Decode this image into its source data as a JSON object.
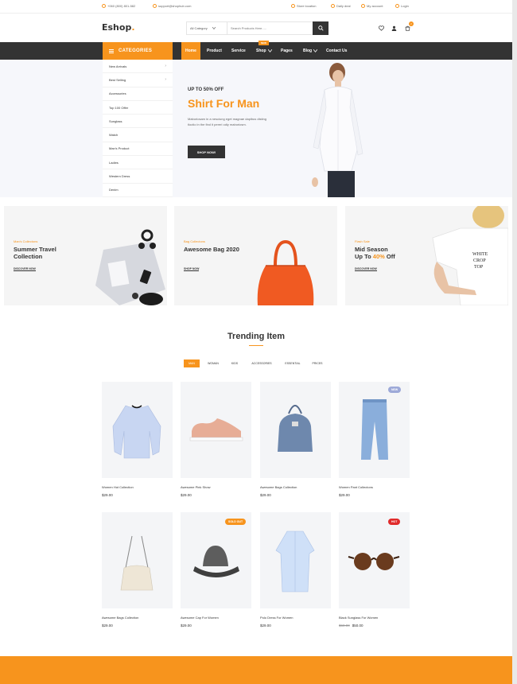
{
  "topbar": {
    "phone": "+060 (800) 801-582",
    "email": "support@shophub.com",
    "store_location": "Store location",
    "daily_deal": "Daily deal",
    "my_account": "My account",
    "login": "Login"
  },
  "header": {
    "logo": "Eshop",
    "logo_dot": ".",
    "category_select": "All Category",
    "search_placeholder": "Search Products Here.....",
    "cart_count": "2"
  },
  "nav": {
    "categories_label": "CATEGORIES",
    "items": [
      "Home",
      "Product",
      "Service",
      "Shop",
      "Pages",
      "Blog",
      "Contact Us"
    ],
    "shop_badge": "NEW"
  },
  "categories": [
    "New Arrivals",
    "Best Selling",
    "Accessories",
    "Top 100 Offer",
    "Sunglass",
    "Watch",
    "Man's Product",
    "Ladies",
    "Western Dress",
    "Denim"
  ],
  "hero": {
    "small": "UP TO 50% OFF",
    "title": "Shirt For Man",
    "desc": "Maboriosam in a nesciung eget magnae dapibus disting tloctio in the find it pereri odiy maboriosm.",
    "button": "SHOP NOW!"
  },
  "promos": [
    {
      "small": "Man's Collectons",
      "title": "Summer Travel Collection",
      "link": "DISCOVER NOW"
    },
    {
      "small": "Bag Collectons",
      "title": "Awesome Bag 2020",
      "link": "SHOP NOW"
    },
    {
      "small": "Flash Sale",
      "title_a": "Mid Season",
      "title_b": "Up To ",
      "title_pct": "40%",
      "title_c": " Off",
      "link": "DISCOVER NOW"
    }
  ],
  "trending": {
    "title": "Trending Item",
    "filters": [
      "MAN",
      "WOMAN",
      "KIDS",
      "ACCESSORIES",
      "ESSENTIAL",
      "PRICES"
    ]
  },
  "products": [
    {
      "name": "Women Hot Collection",
      "price": "$29.00",
      "old_price": "",
      "badge": ""
    },
    {
      "name": "Awesome Pink Show",
      "price": "$29.00",
      "old_price": "",
      "badge": ""
    },
    {
      "name": "Awesome Bags Collection",
      "price": "$29.00",
      "old_price": "",
      "badge": ""
    },
    {
      "name": "Women Pant Collectons",
      "price": "$29.00",
      "old_price": "",
      "badge": "NEW"
    },
    {
      "name": "Awesome Bags Collection",
      "price": "$29.00",
      "old_price": "",
      "badge": ""
    },
    {
      "name": "Awesome Cap For Women",
      "price": "$29.00",
      "old_price": "",
      "badge": "SOLD OUT"
    },
    {
      "name": "Polo Dress For Women",
      "price": "$29.00",
      "old_price": "",
      "badge": ""
    },
    {
      "name": "Black Sunglass For Women",
      "price": "$50.00",
      "old_price": "$60.00",
      "badge": "HOT"
    }
  ],
  "colors": {
    "accent": "#f7941d",
    "dark": "#333333",
    "hot": "#e02b2b",
    "new": "#9da9d8"
  }
}
